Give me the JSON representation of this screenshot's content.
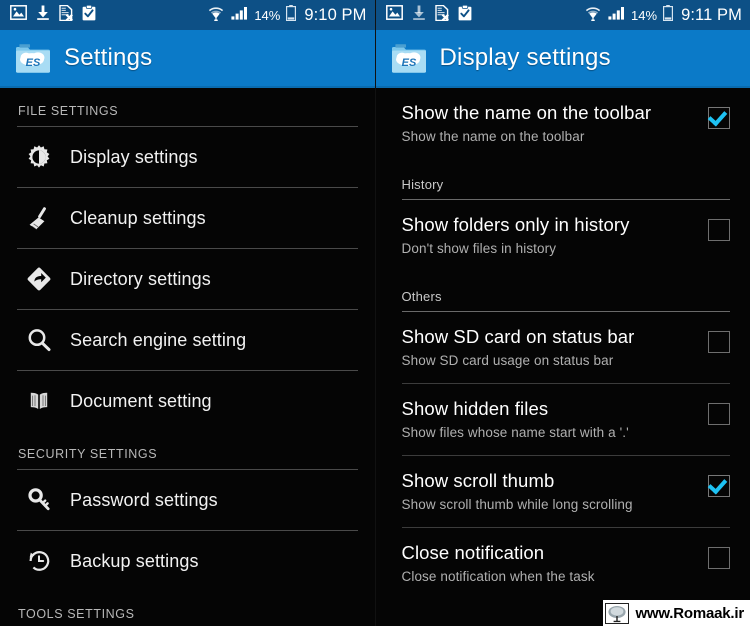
{
  "left_pane": {
    "status_bar": {
      "icons": [
        "image-icon",
        "download-icon",
        "document-error-icon",
        "clipboard-check-icon"
      ],
      "wifi_icon": "wifi-icon",
      "signal_icon": "cellular-signal-icon",
      "battery_percent": "14%",
      "battery_icon": "battery-icon",
      "time": "9:10 PM"
    },
    "title": "Settings",
    "app_icon": "es-file-explorer-icon",
    "sections": [
      {
        "label": "FILE SETTINGS",
        "items": [
          {
            "label": "Display settings",
            "icon": "brightness-gear-icon"
          },
          {
            "label": "Cleanup settings",
            "icon": "broom-icon"
          },
          {
            "label": "Directory settings",
            "icon": "directory-arrow-icon"
          },
          {
            "label": "Search engine setting",
            "icon": "search-icon"
          },
          {
            "label": "Document setting",
            "icon": "book-icon"
          }
        ]
      },
      {
        "label": "SECURITY SETTINGS",
        "items": [
          {
            "label": "Password settings",
            "icon": "key-icon"
          },
          {
            "label": "Backup settings",
            "icon": "history-clock-icon"
          }
        ]
      },
      {
        "label": "TOOLS SETTINGS",
        "items": []
      }
    ]
  },
  "right_pane": {
    "status_bar": {
      "icons": [
        "image-icon",
        "download-icon",
        "document-error-icon",
        "clipboard-check-icon"
      ],
      "wifi_icon": "wifi-icon",
      "signal_icon": "cellular-signal-icon",
      "battery_percent": "14%",
      "battery_icon": "battery-icon",
      "time": "9:11 PM"
    },
    "title": "Display settings",
    "app_icon": "es-file-explorer-icon",
    "preferences": [
      {
        "title": "Show the name on the toolbar",
        "subtitle": "Show the name on the toolbar",
        "checked": true
      },
      {
        "group": "History"
      },
      {
        "title": "Show folders only in history",
        "subtitle": "Don't show files in history",
        "checked": false
      },
      {
        "group": "Others"
      },
      {
        "title": "Show SD card on status bar",
        "subtitle": "Show SD card usage on status bar",
        "checked": false
      },
      {
        "title": "Show hidden files",
        "subtitle": "Show files whose name start with a '.'",
        "checked": false
      },
      {
        "title": "Show scroll thumb",
        "subtitle": "Show scroll thumb while long scrolling",
        "checked": true
      },
      {
        "title": "Close notification",
        "subtitle": "Close notification when the task",
        "checked": false
      }
    ]
  },
  "watermark": {
    "text": "www.Romaak.ir",
    "logo": "romaak-logo-icon"
  },
  "colors": {
    "status_bar": "#0d5086",
    "title_bar": "#0b7ac8",
    "background": "#050505",
    "checkbox_accent": "#1ec2f3"
  }
}
